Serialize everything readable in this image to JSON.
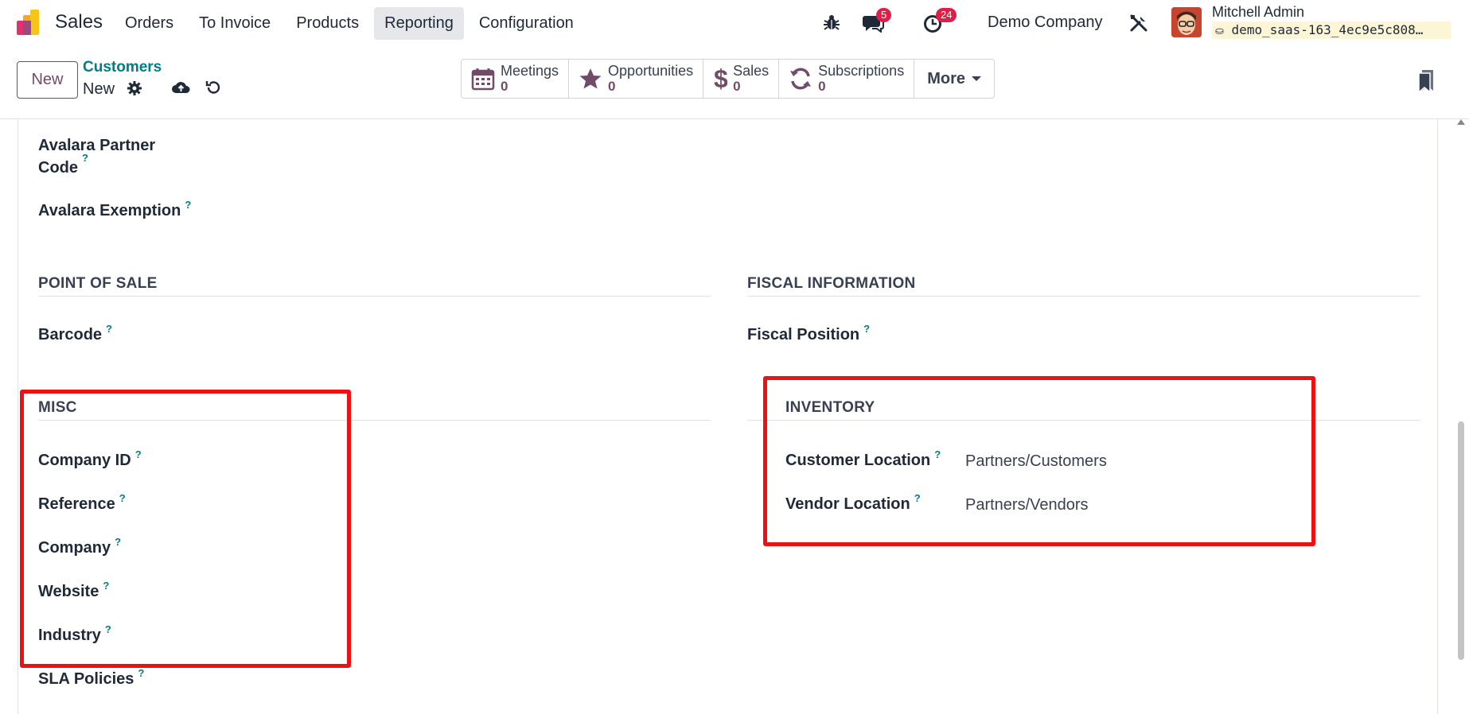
{
  "navbar": {
    "app_name": "Sales",
    "menu": [
      "Orders",
      "To Invoice",
      "Products",
      "Reporting",
      "Configuration"
    ],
    "active_menu": "Reporting",
    "messages_count": "5",
    "activities_count": "24",
    "company": "Demo Company",
    "user_name": "Mitchell Admin",
    "database": "demo_saas-163_4ec9e5c808…"
  },
  "control_panel": {
    "new_label": "New",
    "breadcrumb_parent": "Customers",
    "breadcrumb_current": "New",
    "stats": [
      {
        "label": "Meetings",
        "value": "0",
        "icon": "calendar-icon"
      },
      {
        "label": "Opportunities",
        "value": "0",
        "icon": "star-icon"
      },
      {
        "label": "Sales",
        "value": "0",
        "icon": "dollar-icon"
      },
      {
        "label": "Subscriptions",
        "value": "0",
        "icon": "refresh-icon"
      }
    ],
    "more_label": "More"
  },
  "form": {
    "avalara_partner_code_line1": "Avalara Partner",
    "avalara_partner_code_line2": "Code",
    "avalara_exemption": "Avalara Exemption",
    "tooltip_mark": "?",
    "point_of_sale": {
      "title": "POINT OF SALE",
      "barcode": "Barcode"
    },
    "fiscal_information": {
      "title": "FISCAL INFORMATION",
      "fiscal_position": "Fiscal Position"
    },
    "misc": {
      "title": "MISC",
      "fields": [
        "Company ID",
        "Reference",
        "Company",
        "Website",
        "Industry",
        "SLA Policies"
      ]
    },
    "inventory": {
      "title": "INVENTORY",
      "fields": [
        {
          "label": "Customer Location",
          "value": "Partners/Customers"
        },
        {
          "label": "Vendor Location",
          "value": "Partners/Vendors"
        }
      ]
    }
  },
  "colors": {
    "brand": "#714b67",
    "teal": "#017e84",
    "highlight": "#ee1111",
    "badge": "#e11d48"
  }
}
